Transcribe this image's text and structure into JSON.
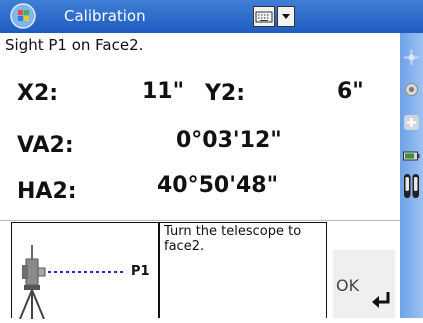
{
  "window": {
    "title": "Calibration"
  },
  "instruction": "Sight P1 on Face2.",
  "readings": {
    "x2_label": "X2:",
    "x2_value": "11\"",
    "y2_label": "Y2:",
    "y2_value": "6\"",
    "va2_label": "VA2:",
    "va2_value": "0°03'12\"",
    "ha2_label": "HA2:",
    "ha2_value": "40°50'48\""
  },
  "diagram": {
    "point_label": "P1"
  },
  "message": "Turn the telescope to face2.",
  "ok_button": {
    "label": "OK"
  },
  "icons": {
    "start": "windows-start-icon",
    "keyboard": "keyboard-icon",
    "dropdown": "chevron-down-icon",
    "side1": "crosshair-icon",
    "side2": "target-icon",
    "side3": "plus-icon",
    "side4": "battery-icon",
    "side5": "bubble-level-icon"
  },
  "colors": {
    "title_bar": "#1e5bbf",
    "sidebar": "#7fb0ee",
    "dashed_line": "#1b2fd6"
  }
}
